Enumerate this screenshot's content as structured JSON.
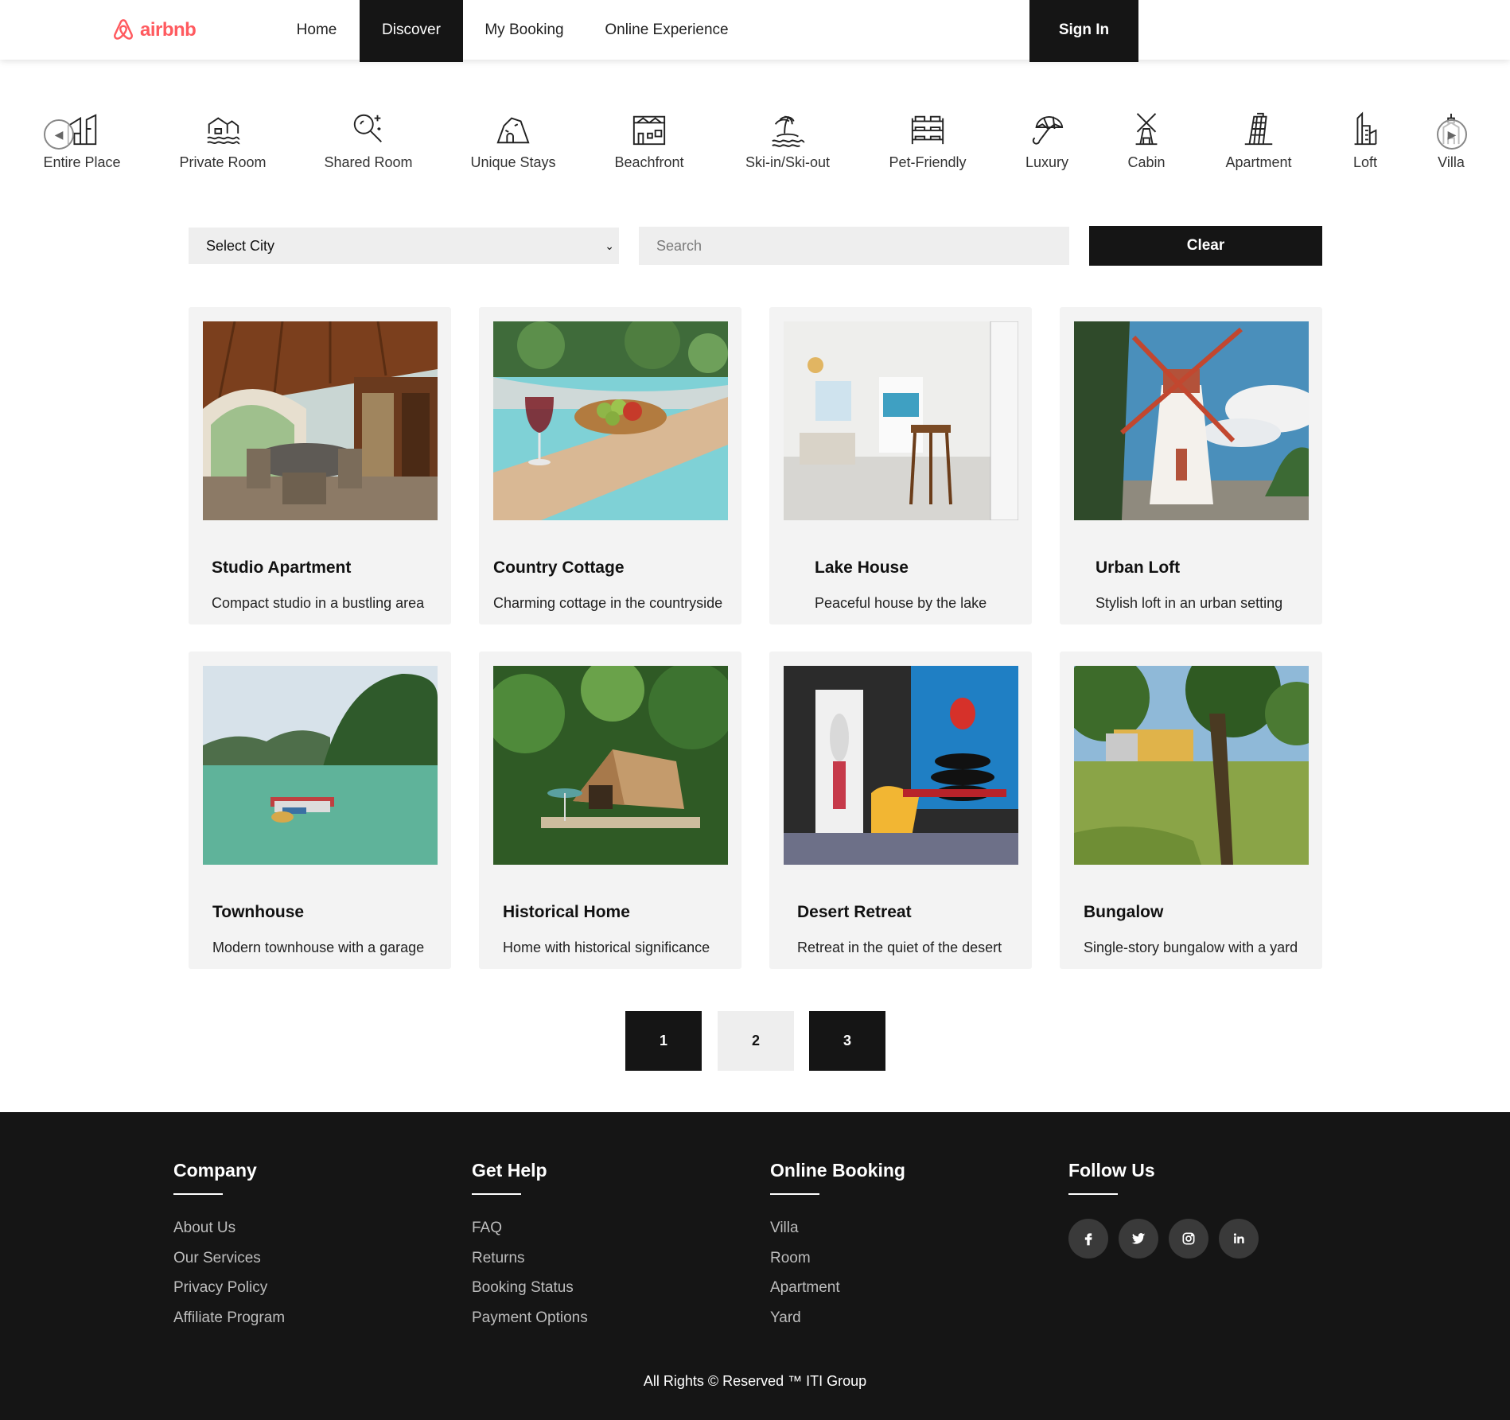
{
  "brand": {
    "name": "airbnb",
    "color": "#ff5a5f"
  },
  "nav": {
    "items": [
      {
        "label": "Home",
        "active": false
      },
      {
        "label": "Discover",
        "active": true
      },
      {
        "label": "My Booking",
        "active": false
      },
      {
        "label": "Online Experience",
        "active": false
      }
    ],
    "signin": "Sign In"
  },
  "categories": [
    {
      "label": "Entire Place",
      "icon": "house-icon"
    },
    {
      "label": "Private Room",
      "icon": "waterfront-house-icon"
    },
    {
      "label": "Shared Room",
      "icon": "magnifier-sparkle-icon"
    },
    {
      "label": "Unique Stays",
      "icon": "cave-icon"
    },
    {
      "label": "Beachfront",
      "icon": "barn-icon"
    },
    {
      "label": "Ski-in/Ski-out",
      "icon": "island-icon"
    },
    {
      "label": "Pet-Friendly",
      "icon": "bunk-bed-icon"
    },
    {
      "label": "Luxury",
      "icon": "umbrella-icon"
    },
    {
      "label": "Cabin",
      "icon": "windmill-icon"
    },
    {
      "label": "Apartment",
      "icon": "leaning-tower-icon"
    },
    {
      "label": "Loft",
      "icon": "ski-icon"
    },
    {
      "label": "Villa",
      "icon": "villa-icon"
    }
  ],
  "filters": {
    "select_value": "Select City",
    "search_placeholder": "Search",
    "clear_label": "Clear"
  },
  "listings": [
    {
      "title": "Studio Apartment",
      "desc": "Compact studio in a bustling area",
      "photo": "terrace-dining-photo"
    },
    {
      "title": "Country Cottage",
      "desc": "Charming cottage in the countryside",
      "photo": "pool-wine-fruit-photo"
    },
    {
      "title": "Lake House",
      "desc": "Peaceful house by the lake",
      "photo": "white-interior-photo"
    },
    {
      "title": "Urban Loft",
      "desc": "Stylish loft in an urban setting",
      "photo": "windmill-photo"
    },
    {
      "title": "Townhouse",
      "desc": "Modern townhouse with a garage",
      "photo": "lake-floating-house-photo"
    },
    {
      "title": "Historical Home",
      "desc": "Home with historical significance",
      "photo": "forest-tent-photo"
    },
    {
      "title": "Desert Retreat",
      "desc": "Retreat in the quiet of the desert",
      "photo": "superhero-room-photo"
    },
    {
      "title": "Bungalow",
      "desc": "Single-story bungalow with a yard",
      "photo": "garden-bungalow-photo"
    }
  ],
  "pagination": [
    "1",
    "2",
    "3"
  ],
  "footer": {
    "columns": [
      {
        "title": "Company",
        "links": [
          "About Us",
          "Our Services",
          "Privacy Policy",
          "Affiliate Program"
        ]
      },
      {
        "title": "Get Help",
        "links": [
          "FAQ",
          "Returns",
          "Booking Status",
          "Payment Options"
        ]
      },
      {
        "title": "Online Booking",
        "links": [
          "Villa",
          "Room",
          "Apartment",
          "Yard"
        ]
      },
      {
        "title": "Follow Us",
        "social": [
          "facebook-icon",
          "twitter-icon",
          "instagram-icon",
          "linkedin-icon"
        ]
      }
    ],
    "copyright": "All Rights © Reserved ™ ITI Group"
  }
}
